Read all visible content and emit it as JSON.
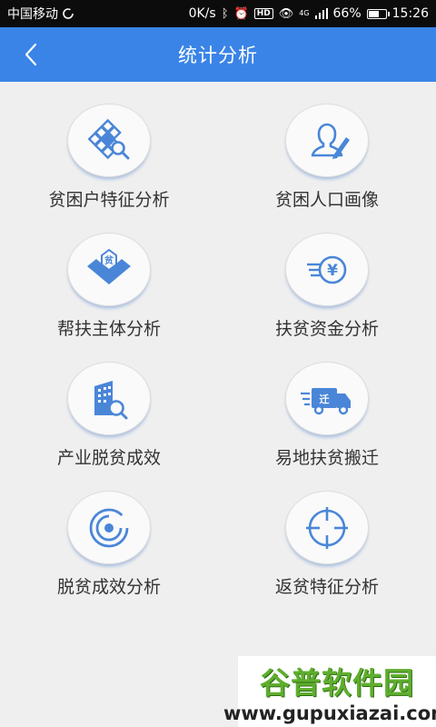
{
  "status_bar": {
    "carrier": "中国移动",
    "net_speed": "0K/s",
    "network": "4G",
    "battery": "66%",
    "battery_level": 0.66,
    "time": "15:26"
  },
  "header": {
    "title": "统计分析",
    "back_icon": "chevron-left-icon"
  },
  "menu": [
    {
      "id": "poverty-household-features",
      "label": "贫困户特征分析",
      "icon": "grid-magnifier-icon"
    },
    {
      "id": "poverty-population-portrait",
      "label": "贫困人口画像",
      "icon": "user-edit-icon"
    },
    {
      "id": "assistance-subject",
      "label": "帮扶主体分析",
      "icon": "handshake-poverty-icon"
    },
    {
      "id": "poverty-funds",
      "label": "扶贫资金分析",
      "icon": "yuan-coin-icon"
    },
    {
      "id": "industry-effect",
      "label": "产业脱贫成效",
      "icon": "building-search-icon"
    },
    {
      "id": "relocation",
      "label": "易地扶贫搬迁",
      "icon": "moving-truck-icon"
    },
    {
      "id": "poverty-exit-effect",
      "label": "脱贫成效分析",
      "icon": "radar-icon"
    },
    {
      "id": "return-poverty-features",
      "label": "返贫特征分析",
      "icon": "crosshair-icon"
    }
  ],
  "colors": {
    "accent": "#3a84e7",
    "icon": "#4a86d8",
    "background": "#efefef"
  },
  "watermark": {
    "title": "谷普软件园",
    "url": "www.gupuxiazai.com"
  }
}
